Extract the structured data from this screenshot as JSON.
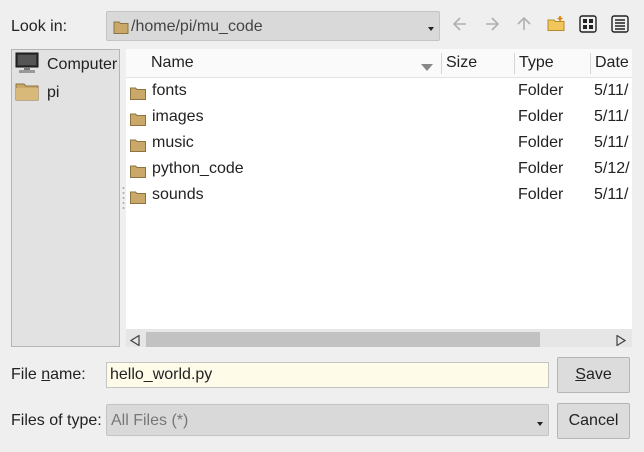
{
  "look_in": {
    "label": "Look in:",
    "path": "/home/pi/mu_code"
  },
  "toolbar": {
    "back_icon": "arrow-left-icon",
    "forward_icon": "arrow-right-icon",
    "up_icon": "arrow-up-icon",
    "new_folder_icon": "new-folder-icon",
    "list_view_icon": "list-view-icon",
    "detail_view_icon": "detail-view-icon"
  },
  "sidebar": {
    "items": [
      {
        "label": "Computer",
        "icon": "computer-icon"
      },
      {
        "label": "pi",
        "icon": "folder-icon"
      }
    ]
  },
  "columns": {
    "name": "Name",
    "size": "Size",
    "type": "Type",
    "date": "Date"
  },
  "files": [
    {
      "name": "fonts",
      "size": "",
      "type": "Folder",
      "date": "5/11/"
    },
    {
      "name": "images",
      "size": "",
      "type": "Folder",
      "date": "5/11/"
    },
    {
      "name": "music",
      "size": "",
      "type": "Folder",
      "date": "5/11/"
    },
    {
      "name": "python_code",
      "size": "",
      "type": "Folder",
      "date": "5/12/"
    },
    {
      "name": "sounds",
      "size": "",
      "type": "Folder",
      "date": "5/11/"
    }
  ],
  "file_name": {
    "label_pre": "File ",
    "label_mn": "n",
    "label_post": "ame:",
    "value": "hello_world.py"
  },
  "file_type": {
    "label": "Files of type:",
    "value": "All Files (*)"
  },
  "buttons": {
    "save_mn": "S",
    "save_rest": "ave",
    "cancel": "Cancel"
  },
  "colors": {
    "folder": "#c9a86a",
    "field_bg": "#fffbe9",
    "dialog_bg": "#efefef"
  }
}
